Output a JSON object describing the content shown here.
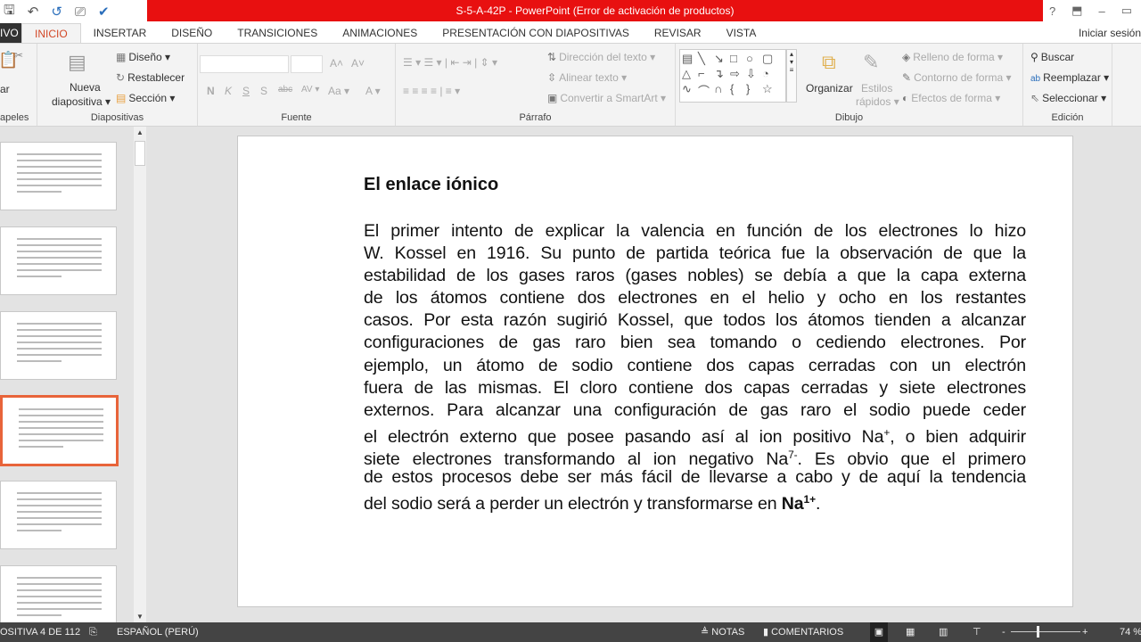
{
  "window": {
    "title": "S-5-A-42P -  PowerPoint (Error de activación de productos)",
    "help": "?",
    "minimize": "–",
    "restore": "▭"
  },
  "tabs": [
    "IVO",
    "INICIO",
    "INSERTAR",
    "DISEÑO",
    "TRANSICIONES",
    "ANIMACIONES",
    "PRESENTACIÓN CON DIAPOSITIVAS",
    "REVISAR",
    "VISTA"
  ],
  "signin": "Iniciar sesión",
  "ribbon": {
    "clipboard": {
      "label": "apeles",
      "paste": "ar"
    },
    "slides": {
      "label": "Diapositivas",
      "new1": "Nueva",
      "new2": "diapositiva ▾",
      "layout": "Diseño ▾",
      "reset": "Restablecer",
      "section": "Sección ▾"
    },
    "font": {
      "label": "Fuente",
      "tools": [
        "N",
        "K",
        "S",
        "S",
        "abc",
        "AV ▾",
        "Aa ▾",
        "A ▾"
      ],
      "grow": "A˄",
      "shrink": "A˅"
    },
    "paragraph": {
      "label": "Párrafo",
      "direction": "Dirección del texto ▾",
      "align": "Alinear texto ▾",
      "smartart": "Convertir a SmartArt ▾"
    },
    "drawing": {
      "label": "Dibujo",
      "arrange": "Organizar",
      "quick1": "Estilos",
      "quick2": "rápidos ▾",
      "fill": "Relleno de forma ▾",
      "outline": "Contorno de forma ▾",
      "effects": "Efectos de forma ▾",
      "shapes": [
        "▤",
        "╲",
        "↘",
        "□",
        "○",
        "▢",
        "△",
        "⌐",
        "↴",
        "⇨",
        "⇩",
        "◔",
        "∿",
        "⌒",
        "∩",
        "{",
        "}",
        "☆"
      ]
    },
    "editing": {
      "label": "Edición",
      "find": "Buscar",
      "replace": "Reemplazar",
      "select": "Seleccionar ▾"
    }
  },
  "slide": {
    "title": "El enlace iónico",
    "lines": [
      [
        {
          "t": "El primer intento de explicar la valencia en función de los electrones lo hizo"
        }
      ],
      [
        {
          "t": "W. Kossel en 1916. Su punto de partida teórica fue la observación de que la"
        }
      ],
      [
        {
          "t": "estabilidad de los gases raros (gases nobles) se debía a que la capa externa"
        }
      ],
      [
        {
          "t": "de los átomos contiene dos electrones en el helio y ocho en los restantes"
        }
      ],
      [
        {
          "t": "casos. Por esta razón sugirió Kossel, que todos los átomos tienden a alcanzar"
        }
      ],
      [
        {
          "t": "configuraciones de gas raro bien sea tomando o cediendo electrones.  Por"
        }
      ],
      [
        {
          "t": "ejemplo, un átomo de sodio contiene dos capas cerradas con un electrón"
        }
      ],
      [
        {
          "t": "fuera de las mismas. El cloro contiene dos capas cerradas y siete electrones"
        }
      ],
      [
        {
          "t": "externos. Para alcanzar una configuración de gas raro el sodio puede ceder"
        }
      ],
      [
        {
          "t": "el electrón externo que posee pasando así al ion positivo Na"
        },
        {
          "t": "+",
          "sup": true
        },
        {
          "t": ", o bien adquirir"
        }
      ],
      [
        {
          "t": "siete electrones transformando al ion negativo Na"
        },
        {
          "t": "7-",
          "sup": true
        },
        {
          "t": ". Es obvio que el primero"
        }
      ],
      [
        {
          "t": "de estos procesos debe ser más fácil de llevarse a cabo y de aquí la tendencia"
        }
      ],
      [
        {
          "t": "del sodio será a perder un electrón y transformarse en "
        },
        {
          "t": "Na",
          "b": true
        },
        {
          "t": "1+",
          "sup": true,
          "b": true
        },
        {
          "t": "."
        }
      ]
    ]
  },
  "status": {
    "slide": "OSITIVA 4 DE 112",
    "language": "ESPAÑOL (PERÚ)",
    "notes": "NOTAS",
    "comments": "COMENTARIOS",
    "zoom": "74 %",
    "zoom_value": 74
  }
}
